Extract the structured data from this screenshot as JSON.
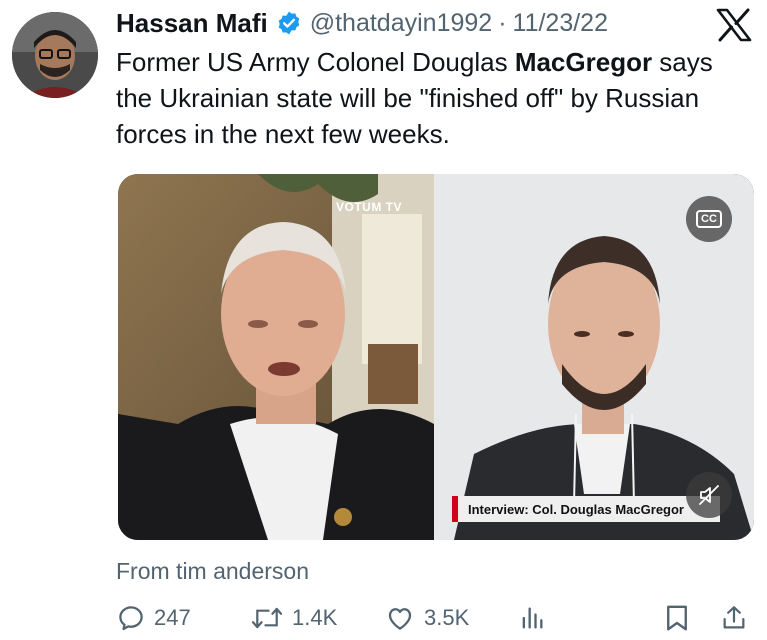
{
  "author": {
    "name": "Hassan Mafi",
    "handle": "@thatdayin1992",
    "separator": "·",
    "date": "11/23/22"
  },
  "tweet": {
    "text_part1": "Former US Army Colonel Douglas ",
    "text_bold": "MacGregor",
    "text_part2": " says the Ukrainian state will be \"finished off\" by Russian forces in the next few weeks."
  },
  "video": {
    "watermark": "VOTUM TV",
    "cc_label": "CC",
    "lower_third": "Interview: Col. Douglas MacGregor"
  },
  "source": "From tim anderson",
  "actions": {
    "replies": "247",
    "reposts": "1.4K",
    "likes": "3.5K"
  },
  "colors": {
    "verified": "#1d9bf0",
    "secondary_text": "#536471",
    "lower_third_accent": "#d0021b"
  },
  "icons": [
    "verified-badge-icon",
    "x-logo-icon",
    "cc-icon",
    "mute-icon",
    "reply-icon",
    "repost-icon",
    "like-icon",
    "views-icon",
    "bookmark-icon",
    "share-icon"
  ]
}
